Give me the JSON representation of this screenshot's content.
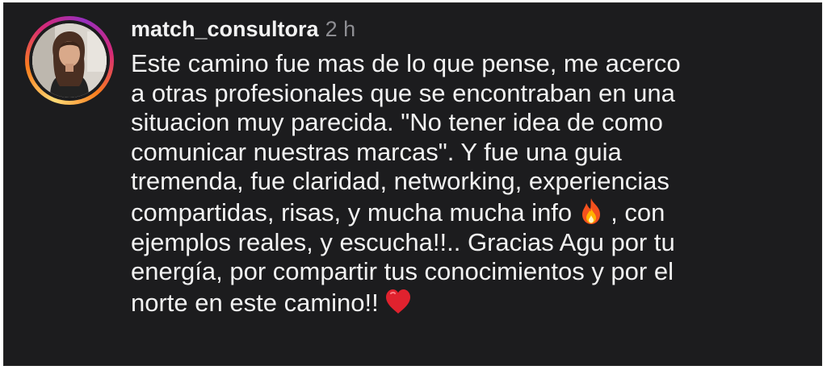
{
  "comment": {
    "username": "match_consultora",
    "time": "2 h",
    "lines": [
      "Este camino fue mas de lo que pense, me acerco",
      "a otras profesionales que se encontraban en una",
      "situacion muy parecida. \"No tener idea de como",
      "comunicar nuestras marcas\". Y fue una guia",
      "tremenda, fue claridad, networking, experiencias"
    ],
    "line6_before": "compartidas, risas, y mucha mucha info",
    "line6_after": ", con",
    "lines_after": [
      "ejemplos reales, y escucha!!.. Gracias Agu por tu",
      "energía, por compartir tus conocimientos y por el"
    ],
    "last_line": "norte en este camino!!",
    "emoji_1": "fire-emoji",
    "emoji_2": "red-heart-emoji"
  },
  "colors": {
    "background": "#1c1c1e",
    "text": "#f2f2f2",
    "time": "#8e8e93",
    "story_ring": [
      "#feda75",
      "#fa7e1e",
      "#d62976",
      "#962fbf"
    ]
  }
}
